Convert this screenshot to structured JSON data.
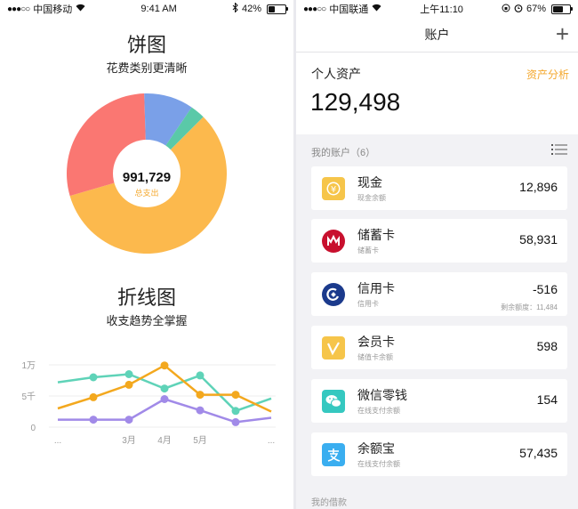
{
  "left": {
    "status": {
      "carrier": "中国移动",
      "time": "9:41 AM",
      "battery": "42%",
      "battery_level": 0.42
    },
    "pie_title": "饼图",
    "pie_subtitle": "花费类别更清晰",
    "pie_center_value": "991,729",
    "pie_center_label": "总支出",
    "line_title": "折线图",
    "line_subtitle": "收支趋势全掌握"
  },
  "right": {
    "status": {
      "carrier": "中国联通",
      "time": "上午11:10",
      "battery": "67%",
      "battery_level": 0.67
    },
    "nav_title": "账户",
    "assets_label": "个人资产",
    "assets_link": "资产分析",
    "assets_value": "129,498",
    "accounts_header": "我的账户（6）",
    "accounts": [
      {
        "name": "现金",
        "desc": "现金余额",
        "amount": "12,896",
        "note": "",
        "icon": "cash-icon",
        "color": "#f6c54a"
      },
      {
        "name": "储蓄卡",
        "desc": "储蓄卡",
        "amount": "58,931",
        "note": "",
        "icon": "bank-logo-icon",
        "color": "#c8102e"
      },
      {
        "name": "信用卡",
        "desc": "信用卡",
        "amount": "-516",
        "note": "剩余额度：11,484",
        "icon": "ccb-logo-icon",
        "color": "#1b3a8c"
      },
      {
        "name": "会员卡",
        "desc": "储值卡余额",
        "amount": "598",
        "note": "",
        "icon": "vip-card-icon",
        "color": "#f6c54a"
      },
      {
        "name": "微信零钱",
        "desc": "在线支付余额",
        "amount": "154",
        "note": "",
        "icon": "wechat-icon",
        "color": "#35c8c0"
      },
      {
        "name": "余额宝",
        "desc": "在线支付余额",
        "amount": "57,435",
        "note": "",
        "icon": "alipay-icon",
        "color": "#3aaef0"
      }
    ],
    "bottom_label": "我的借款"
  },
  "chart_data": [
    {
      "type": "pie",
      "title": "饼图",
      "subtitle": "花费类别更清晰",
      "categories": [
        "",
        "",
        "",
        ""
      ],
      "values": [
        0.58,
        0.29,
        0.1,
        0.03
      ],
      "colors": [
        "#fcb94d",
        "#fa7772",
        "#7aa0e8",
        "#5ac9a8"
      ],
      "total": "991,729"
    },
    {
      "type": "line",
      "title": "折线图",
      "subtitle": "收支趋势全掌握",
      "x": [
        "...",
        "",
        "3月",
        "4月",
        "5月",
        "",
        "..."
      ],
      "yticks": [
        "0",
        "5千",
        "1万"
      ],
      "ylim": [
        0,
        10000
      ],
      "series": [
        {
          "values": [
            7200,
            8000,
            8500,
            6200,
            8300,
            2600,
            4600
          ],
          "color": "#5fd3b8"
        },
        {
          "values": [
            3000,
            4800,
            6800,
            9900,
            5200,
            5200,
            2500
          ],
          "color": "#f3a81e"
        },
        {
          "values": [
            1200,
            1200,
            1200,
            4500,
            2700,
            800,
            1500
          ],
          "color": "#a18ae8"
        }
      ]
    }
  ]
}
